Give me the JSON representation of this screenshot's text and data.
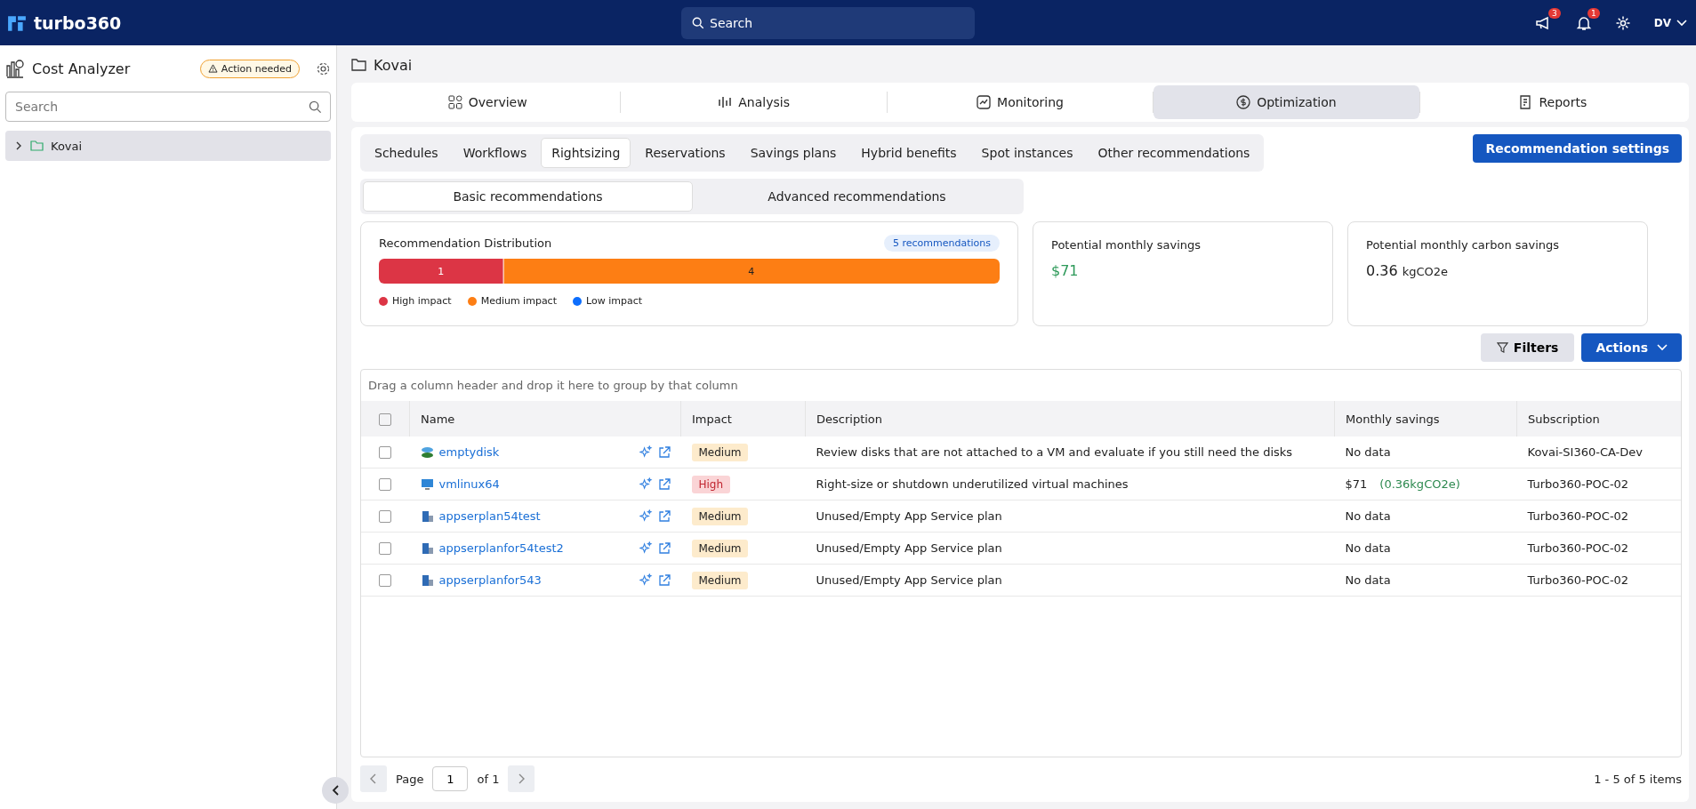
{
  "header": {
    "brand": "turbo360",
    "search_placeholder": "Search",
    "announcements_badge": "3",
    "notifications_badge": "1",
    "avatar": "DV"
  },
  "sidebar": {
    "title": "Cost Analyzer",
    "action_badge": "Action needed",
    "search_placeholder": "Search",
    "tree": [
      {
        "label": "Kovai",
        "expanded": false,
        "selected": true
      }
    ]
  },
  "breadcrumb": "Kovai",
  "main_tabs": [
    {
      "label": "Overview",
      "kind": "overview",
      "selected": false
    },
    {
      "label": "Analysis",
      "kind": "analysis",
      "selected": false
    },
    {
      "label": "Monitoring",
      "kind": "monitoring",
      "selected": false
    },
    {
      "label": "Optimization",
      "kind": "optimization",
      "selected": true
    },
    {
      "label": "Reports",
      "kind": "reports",
      "selected": false
    }
  ],
  "sub_tabs": [
    {
      "label": "Schedules",
      "selected": false
    },
    {
      "label": "Workflows",
      "selected": false
    },
    {
      "label": "Rightsizing",
      "selected": true
    },
    {
      "label": "Reservations",
      "selected": false
    },
    {
      "label": "Savings plans",
      "selected": false
    },
    {
      "label": "Hybrid benefits",
      "selected": false
    },
    {
      "label": "Spot instances",
      "selected": false
    },
    {
      "label": "Other recommendations",
      "selected": false
    }
  ],
  "settings_button": "Recommendation settings",
  "mode_tabs": [
    {
      "label": "Basic recommendations",
      "selected": true
    },
    {
      "label": "Advanced recommendations",
      "selected": false
    }
  ],
  "distribution": {
    "title": "Recommendation Distribution",
    "count_badge": "5 recommendations",
    "chart_data": {
      "type": "bar",
      "orientation": "horizontal",
      "stacked": true,
      "legend": "bottom",
      "data_labels": true,
      "series": [
        {
          "name": "High impact",
          "color": "#dc3545",
          "values": [
            1
          ]
        },
        {
          "name": "Medium impact",
          "color": "#fd7e14",
          "values": [
            4
          ]
        },
        {
          "name": "Low impact",
          "color": "#0d6efd",
          "values": [
            null
          ]
        }
      ]
    }
  },
  "savings_card": {
    "title": "Potential monthly savings",
    "value": "$71"
  },
  "carbon_card": {
    "title": "Potential monthly carbon savings",
    "value": "0.36",
    "unit": "kgCO2e"
  },
  "filters_button": "Filters",
  "actions_button": "Actions",
  "group_hint": "Drag a column header and drop it here to group by that column",
  "table": {
    "select_all_checked": false,
    "columns": [
      "Name",
      "Impact",
      "Description",
      "Monthly savings",
      "Subscription"
    ],
    "rows": [
      {
        "checked": false,
        "kind": "disk",
        "name": "emptydisk",
        "impact": {
          "label": "Medium",
          "color": "#fdebcc"
        },
        "description": "Review disks that are not attached to a VM and evaluate if you still need the disks",
        "savings": "No data",
        "subscription": "Kovai-SI360-CA-Dev"
      },
      {
        "checked": false,
        "kind": "vm",
        "name": "vmlinux64",
        "impact": {
          "label": "High",
          "color": "#fad4d6"
        },
        "description": "Right-size or shutdown underutilized virtual machines",
        "savings": "$71",
        "carbon": "(0.36kgCO2e)",
        "subscription": "Turbo360-POC-02"
      },
      {
        "checked": false,
        "kind": "plan",
        "name": "appserplan54test",
        "impact": {
          "label": "Medium",
          "color": "#fdebcc"
        },
        "description": "Unused/Empty App Service plan",
        "savings": "No data",
        "subscription": "Turbo360-POC-02"
      },
      {
        "checked": false,
        "kind": "plan",
        "name": "appserplanfor54test2",
        "impact": {
          "label": "Medium",
          "color": "#fdebcc"
        },
        "description": "Unused/Empty App Service plan",
        "savings": "No data",
        "subscription": "Turbo360-POC-02"
      },
      {
        "checked": false,
        "kind": "plan",
        "name": "appserplanfor543",
        "impact": {
          "label": "Medium",
          "color": "#fdebcc"
        },
        "description": "Unused/Empty App Service plan",
        "savings": "No data",
        "subscription": "Turbo360-POC-02"
      }
    ]
  },
  "pager": {
    "label": "Page",
    "page": "1",
    "of": "of 1",
    "summary": "1 - 5 of 5 items"
  }
}
